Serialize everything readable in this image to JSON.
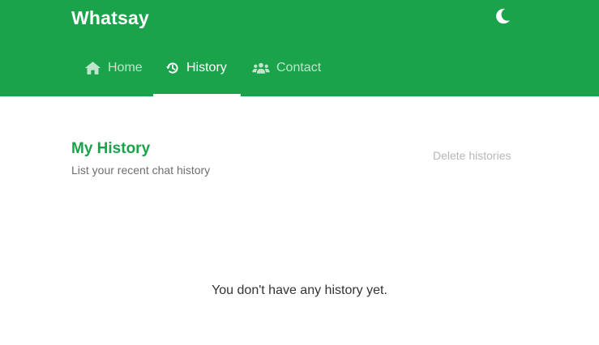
{
  "app": {
    "brand": "Whatsay",
    "theme_icon": "moon-icon",
    "accent_color": "#1aa34a"
  },
  "nav": {
    "tabs": [
      {
        "label": "Home",
        "icon": "home-icon",
        "active": false
      },
      {
        "label": "History",
        "icon": "history-icon",
        "active": true
      },
      {
        "label": "Contact",
        "icon": "users-icon",
        "active": false
      }
    ]
  },
  "page": {
    "title": "My History",
    "subtitle": "List your recent chat history",
    "delete_label": "Delete histories",
    "empty_message": "You don't have any history yet."
  }
}
